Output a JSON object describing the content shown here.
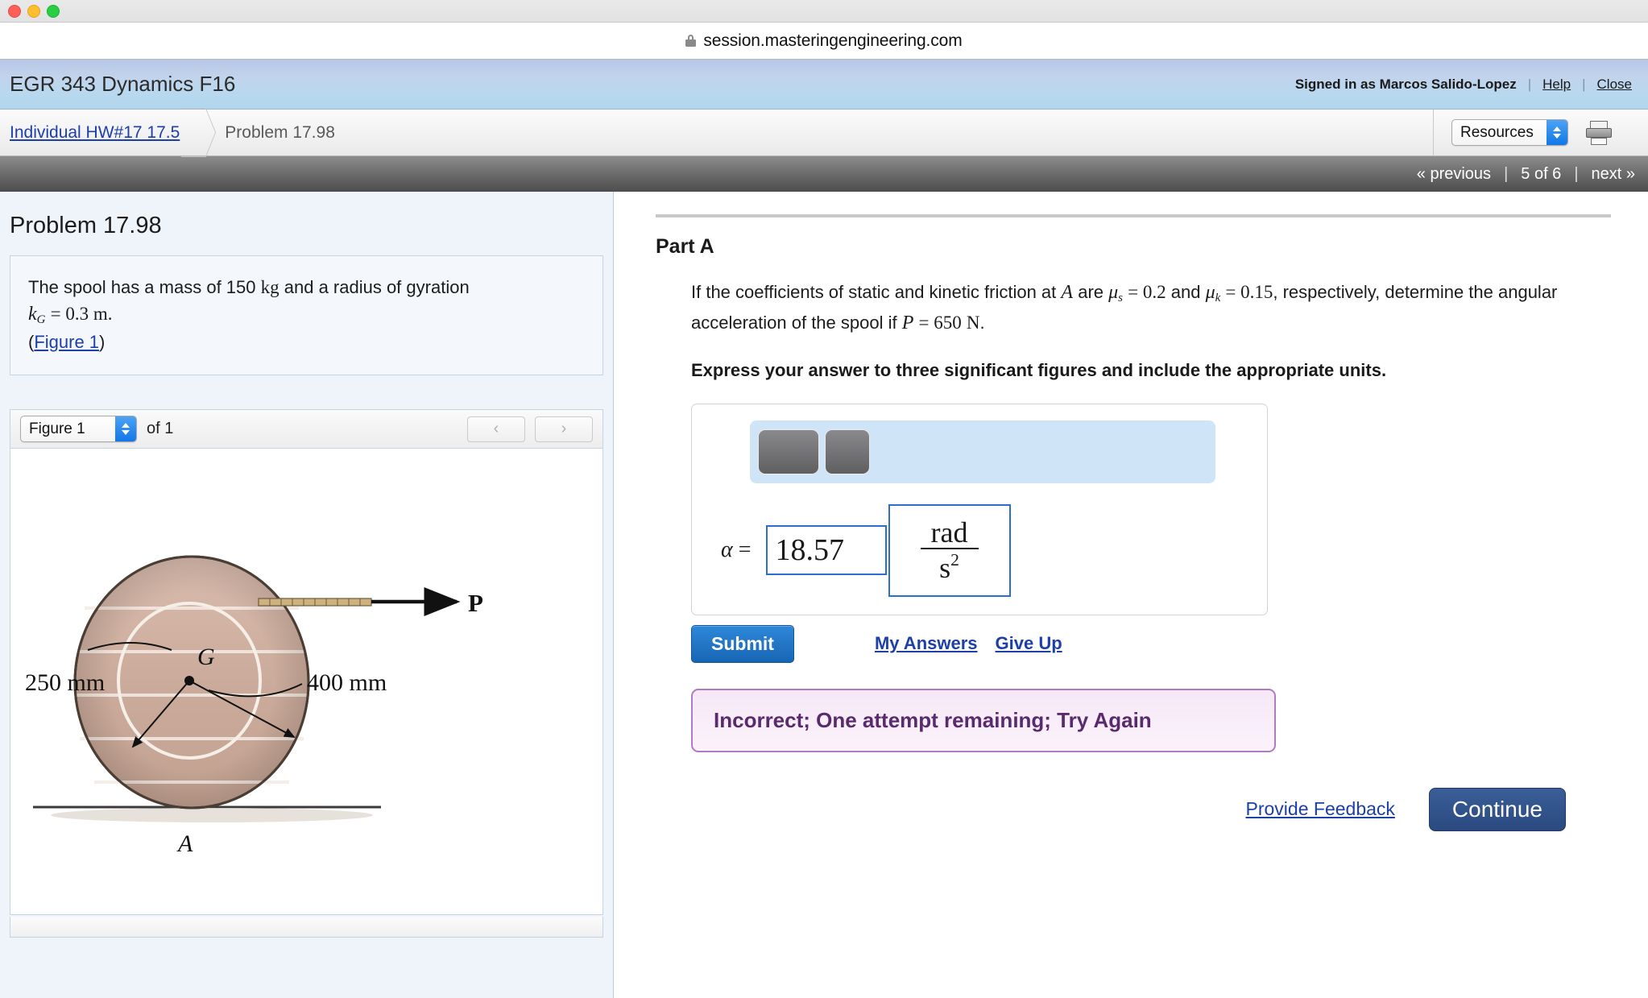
{
  "browser": {
    "url": "session.masteringengineering.com",
    "lock_icon": "lock-icon",
    "traffic_lights": [
      "close-red",
      "minimize-yellow",
      "maximize-green"
    ]
  },
  "header": {
    "course_title": "EGR 343 Dynamics F16",
    "signed_in": "Signed in as Marcos Salido-Lopez",
    "help_label": "Help",
    "close_label": "Close",
    "separator": "|"
  },
  "breadcrumb": {
    "parent": "Individual HW#17 17.5",
    "current": "Problem 17.98",
    "resources_label": "Resources",
    "print_icon": "printer-icon"
  },
  "pager": {
    "previous_label": "« previous",
    "count_label": "5 of 6",
    "next_label": "next »",
    "separator": "|"
  },
  "problem": {
    "title": "Problem 17.98",
    "statement_part1": "The spool has a mass of 150",
    "statement_unit_kg": "kg",
    "statement_part2": "and a radius of gyration",
    "kg_symbol": "k",
    "kg_subscript": "G",
    "kg_value": "= 0.3 m.",
    "figure_link_open": "(",
    "figure_link": "Figure 1",
    "figure_link_close": ")"
  },
  "figure": {
    "selected": "Figure 1",
    "of_label": "of 1",
    "prev_icon": "chevron-left-icon",
    "next_icon": "chevron-right-icon",
    "diagram": {
      "label_left": "250 mm",
      "label_right": "400 mm",
      "label_center": "G",
      "label_force": "P",
      "label_contact": "A"
    }
  },
  "part": {
    "title": "Part A",
    "q_1": "If the coefficients of static and kinetic friction at",
    "q_A": "A",
    "q_2": "are",
    "q_mu_s": "μ",
    "q_mu_s_sub": "s",
    "q_mu_s_val": "= 0.2",
    "q_3": "and",
    "q_mu_k": "μ",
    "q_mu_k_sub": "k",
    "q_mu_k_val": "= 0.15",
    "q_4": ", respectively, determine the angular acceleration of the spool if",
    "q_P": "P",
    "q_P_val": "= 650",
    "q_N": "N",
    "q_5": ".",
    "emphasis": "Express your answer to three significant figures and include the appropriate units."
  },
  "answer": {
    "math_toolbar_buttons": [
      "math-template-button-1",
      "math-template-button-2"
    ],
    "variable_symbol": "α",
    "equals": "=",
    "value": "18.57",
    "unit_numerator": "rad",
    "unit_denominator": "s",
    "unit_denominator_exponent": "2"
  },
  "actions": {
    "submit_label": "Submit",
    "my_answers_label": "My Answers",
    "give_up_label": "Give Up",
    "provide_feedback_label": "Provide Feedback",
    "continue_label": "Continue"
  },
  "status": {
    "message": "Incorrect; One attempt remaining; Try Again",
    "text_color": "#5a2a6e",
    "background_color": "#f6e7f6",
    "border_color": "#b07cc0"
  },
  "colors": {
    "header_blue": "#b8d8ef",
    "link_blue": "#1d3faa",
    "submit_blue": "#1766b5",
    "continue_blue": "#2a4a80",
    "input_border_blue": "#2a6fd0",
    "panel_bg": "#eff4fa"
  }
}
